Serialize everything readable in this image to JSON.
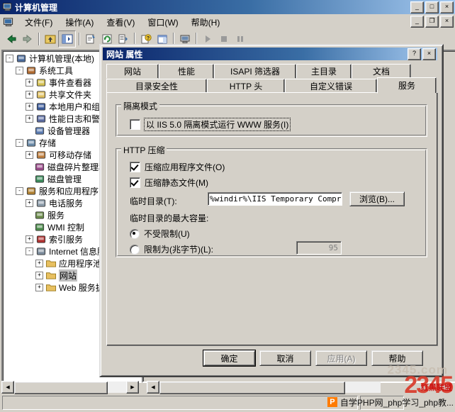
{
  "window": {
    "title": "计算机管理",
    "icon": "computer-icon",
    "controls": {
      "minimize": "_",
      "maximize": "□",
      "close": "×"
    },
    "mdi_controls": {
      "minimize": "_",
      "restore": "❐",
      "close": "×"
    }
  },
  "menu": {
    "items": [
      {
        "label": "文件(F)"
      },
      {
        "label": "操作(A)"
      },
      {
        "label": "查看(V)"
      },
      {
        "label": "窗口(W)"
      },
      {
        "label": "帮助(H)"
      }
    ]
  },
  "toolbar": {
    "buttons": [
      {
        "name": "back-icon",
        "glyph": "⬅",
        "color": "#1a7a3a"
      },
      {
        "name": "forward-icon",
        "glyph": "➡",
        "color": "#7a8a7a"
      },
      {
        "name": "up-one-level-icon",
        "glyph": "▲",
        "color": "#c8a030"
      },
      {
        "name": "show-hide-tree-icon",
        "glyph": "◧",
        "color": "#2b4c8c"
      },
      {
        "name": "properties-icon",
        "glyph": "▤",
        "color": "#8a8a8a"
      },
      {
        "name": "refresh-icon",
        "glyph": "↻",
        "color": "#2a8a3a"
      },
      {
        "name": "export-list-icon",
        "glyph": "▤",
        "color": "#6a6a6a"
      },
      {
        "name": "help-icon",
        "glyph": "?",
        "color": "#d0a020"
      },
      {
        "name": "detail-view-icon",
        "glyph": "▥",
        "color": "#2b4c8c"
      },
      {
        "name": "connect-computer-icon",
        "glyph": "▭",
        "color": "#4a6a9a"
      },
      {
        "name": "start-service-icon",
        "glyph": "▶",
        "color": "#909090"
      },
      {
        "name": "stop-service-icon",
        "glyph": "■",
        "color": "#909090"
      },
      {
        "name": "pause-service-icon",
        "glyph": "❚❚",
        "color": "#909090"
      }
    ]
  },
  "tree": {
    "nodes": [
      {
        "label": "计算机管理(本地)",
        "indent": 0,
        "expander": "-",
        "icon": "computer-icon",
        "icon_color": "#4a6a9a",
        "selected": false
      },
      {
        "label": "系统工具",
        "indent": 1,
        "expander": "-",
        "icon": "system-tools-icon",
        "icon_color": "#b06a30",
        "selected": false
      },
      {
        "label": "事件查看器",
        "indent": 2,
        "expander": "+",
        "icon": "event-viewer-icon",
        "icon_color": "#d4c050",
        "selected": false
      },
      {
        "label": "共享文件夹",
        "indent": 2,
        "expander": "+",
        "icon": "shared-folders-icon",
        "icon_color": "#e0c060",
        "selected": false
      },
      {
        "label": "本地用户和组",
        "indent": 2,
        "expander": "+",
        "icon": "local-users-groups-icon",
        "icon_color": "#3a5a9a",
        "selected": false
      },
      {
        "label": "性能日志和警报",
        "indent": 2,
        "expander": "+",
        "icon": "performance-logs-icon",
        "icon_color": "#5a6aa0",
        "selected": false
      },
      {
        "label": "设备管理器",
        "indent": 2,
        "expander": "",
        "icon": "device-manager-icon",
        "icon_color": "#5a7ab0",
        "selected": false
      },
      {
        "label": "存储",
        "indent": 1,
        "expander": "-",
        "icon": "storage-icon",
        "icon_color": "#6a8aa8",
        "selected": false
      },
      {
        "label": "可移动存储",
        "indent": 2,
        "expander": "+",
        "icon": "removable-storage-icon",
        "icon_color": "#c08040",
        "selected": false
      },
      {
        "label": "磁盘碎片整理程序",
        "indent": 2,
        "expander": "",
        "icon": "disk-defragmenter-icon",
        "icon_color": "#9a4a8a",
        "selected": false
      },
      {
        "label": "磁盘管理",
        "indent": 2,
        "expander": "",
        "icon": "disk-management-icon",
        "icon_color": "#3a8a5a",
        "selected": false
      },
      {
        "label": "服务和应用程序",
        "indent": 1,
        "expander": "-",
        "icon": "services-applications-icon",
        "icon_color": "#b08030",
        "selected": false
      },
      {
        "label": "电话服务",
        "indent": 2,
        "expander": "+",
        "icon": "telephony-icon",
        "icon_color": "#8a9aa8",
        "selected": false
      },
      {
        "label": "服务",
        "indent": 2,
        "expander": "",
        "icon": "services-icon",
        "icon_color": "#6a8a4a",
        "selected": false
      },
      {
        "label": "WMI 控制",
        "indent": 2,
        "expander": "",
        "icon": "wmi-control-icon",
        "icon_color": "#4a8a4a",
        "selected": false
      },
      {
        "label": "索引服务",
        "indent": 2,
        "expander": "+",
        "icon": "indexing-service-icon",
        "icon_color": "#b03030",
        "selected": false
      },
      {
        "label": "Internet 信息服务",
        "indent": 2,
        "expander": "-",
        "icon": "iis-icon",
        "icon_color": "#7a8a9a",
        "selected": false
      },
      {
        "label": "应用程序池",
        "indent": 3,
        "expander": "+",
        "icon": "folder-icon",
        "icon_color": "#e8c060",
        "selected": false
      },
      {
        "label": "网站",
        "indent": 3,
        "expander": "+",
        "icon": "folder-icon",
        "icon_color": "#e8c060",
        "selected": true
      },
      {
        "label": "Web 服务扩展",
        "indent": 3,
        "expander": "+",
        "icon": "folder-icon",
        "icon_color": "#e8c060",
        "selected": false
      }
    ]
  },
  "dialog": {
    "title": "网站 属性",
    "help_button": "?",
    "close_button": "×",
    "tabs_row1": [
      {
        "label": "网站",
        "active": false
      },
      {
        "label": "性能",
        "active": false
      },
      {
        "label": "ISAPI 筛选器",
        "active": false
      },
      {
        "label": "主目录",
        "active": false
      },
      {
        "label": "文档",
        "active": false
      }
    ],
    "tabs_row2": [
      {
        "label": "目录安全性",
        "active": false
      },
      {
        "label": "HTTP 头",
        "active": false
      },
      {
        "label": "自定义错误",
        "active": false
      },
      {
        "label": "服务",
        "active": true
      }
    ],
    "isolation": {
      "legend": "隔离模式",
      "checkbox_label": "以 IIS 5.0 隔离模式运行 WWW 服务(I)",
      "checked": false,
      "focused": true
    },
    "compression": {
      "legend": "HTTP 压缩",
      "check_app_files": {
        "label": "压缩应用程序文件(O)",
        "checked": true
      },
      "check_static_files": {
        "label": "压缩静态文件(M)",
        "checked": true
      },
      "temp_dir_label": "临时目录(T):",
      "temp_dir_value": "%windir%\\IIS Temporary Compres",
      "browse_button": "浏览(B)...",
      "max_size_label": "临时目录的最大容量:",
      "radio_unlimited": {
        "label": "不受限制(U)",
        "selected": true
      },
      "radio_limited": {
        "label": "限制为(兆字节)(L):",
        "selected": false
      },
      "limit_value": "95",
      "limit_enabled": false
    },
    "buttons": [
      {
        "label": "确定",
        "default": true,
        "disabled": false
      },
      {
        "label": "取消",
        "default": false,
        "disabled": false
      },
      {
        "label": "应用(A)",
        "default": false,
        "disabled": true
      },
      {
        "label": "帮助",
        "default": false,
        "disabled": false
      }
    ]
  },
  "watermark": {
    "top_text": "2345.com",
    "brand": "2345",
    "red_text": "红黑联盟",
    "taskbar_text": "自学PHP网_php学习_php教..."
  }
}
